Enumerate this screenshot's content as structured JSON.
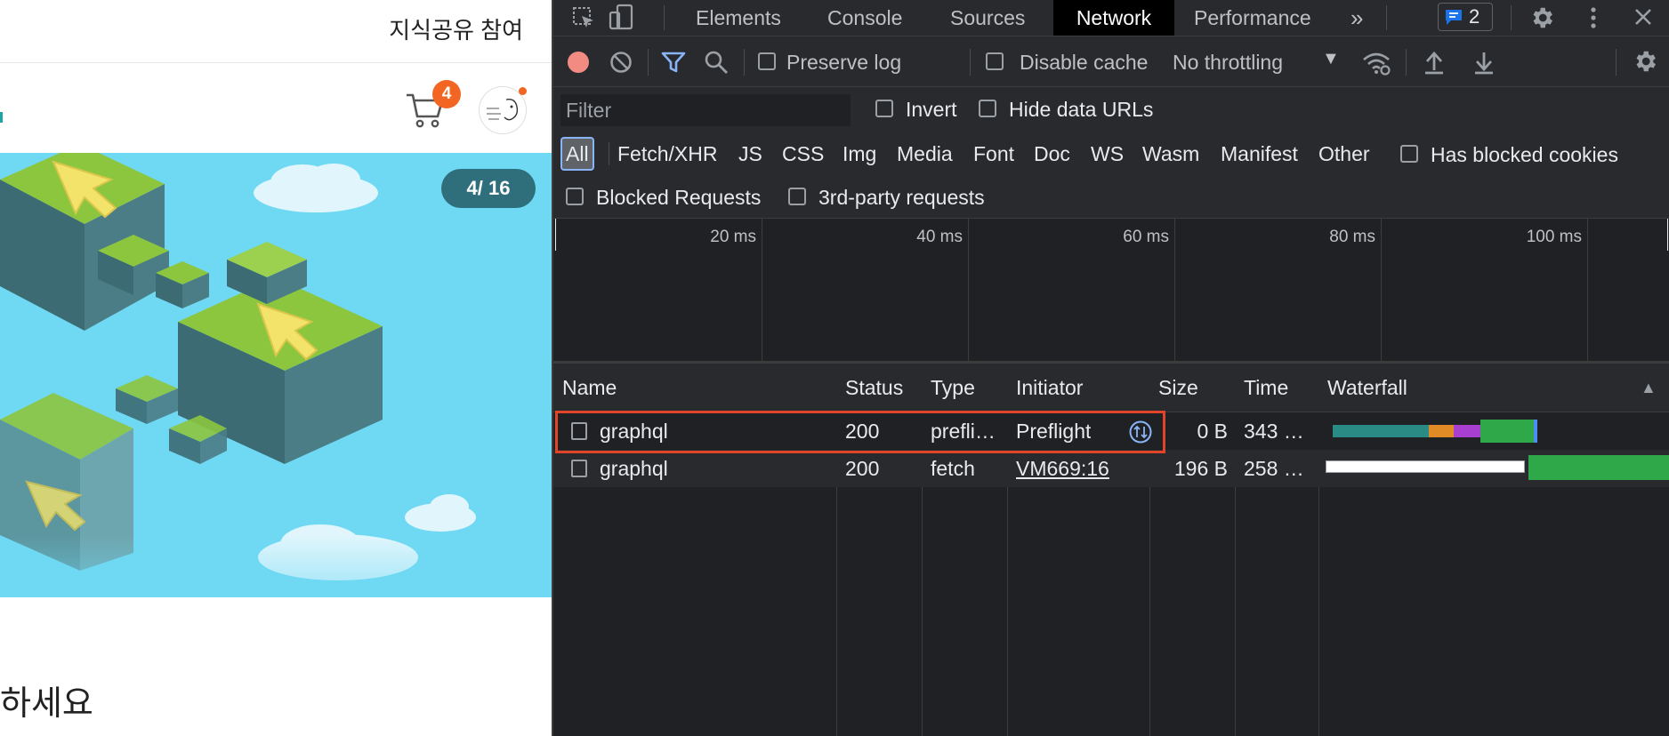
{
  "page": {
    "top_link": "지식공유 참여",
    "cart_count": "4",
    "slide_counter": "4/ 16",
    "bottom_text": "하세요",
    "colors": {
      "badge": "#f26522",
      "banner": "#6fd8f3",
      "counter_bg": "#2f6f7c"
    }
  },
  "devtools": {
    "tabs": [
      "Elements",
      "Console",
      "Sources",
      "Network",
      "Performance"
    ],
    "active_tab": "Network",
    "more_tabs_icon": "chevron-double-right-icon",
    "issues_count": "2",
    "toolbar": {
      "preserve_log": "Preserve log",
      "disable_cache": "Disable cache",
      "throttling": "No throttling"
    },
    "filter": {
      "placeholder": "Filter",
      "invert": "Invert",
      "hide_data_urls": "Hide data URLs",
      "types": [
        "All",
        "Fetch/XHR",
        "JS",
        "CSS",
        "Img",
        "Media",
        "Font",
        "Doc",
        "WS",
        "Wasm",
        "Manifest",
        "Other"
      ],
      "has_blocked_cookies": "Has blocked cookies",
      "blocked_requests": "Blocked Requests",
      "third_party": "3rd-party requests"
    },
    "overview_ticks": [
      "20 ms",
      "40 ms",
      "60 ms",
      "80 ms",
      "100 ms"
    ],
    "table": {
      "columns": [
        "Name",
        "Status",
        "Type",
        "Initiator",
        "Size",
        "Time",
        "Waterfall"
      ],
      "rows": [
        {
          "name": "graphql",
          "status": "200",
          "type": "prefli…",
          "initiator": "Preflight",
          "size": "0 B",
          "time": "343 …"
        },
        {
          "name": "graphql",
          "status": "200",
          "type": "fetch",
          "initiator": "VM669:16",
          "size": "196 B",
          "time": "258 …"
        }
      ]
    },
    "colors": {
      "bg": "#202124",
      "panel": "#292a2d",
      "accent": "#8ab4f8",
      "record": "#f28b82",
      "highlight": "#e0452a"
    }
  }
}
